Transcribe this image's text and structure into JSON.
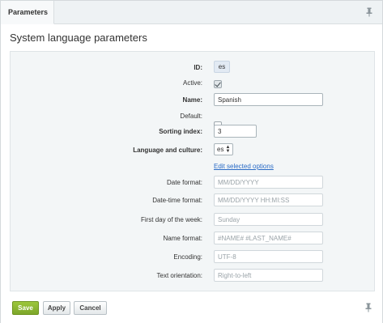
{
  "tab": {
    "label": "Parameters"
  },
  "title": "System language parameters",
  "form": {
    "id": {
      "label": "ID:",
      "value": "es"
    },
    "active": {
      "label": "Active:",
      "checked": true
    },
    "name": {
      "label": "Name:",
      "value": "Spanish"
    },
    "default": {
      "label": "Default:",
      "checked": false
    },
    "sorting_index": {
      "label": "Sorting index:",
      "value": "3"
    },
    "language_culture": {
      "label": "Language and culture:",
      "value": "es"
    },
    "edit_link": "Edit selected options",
    "date_format": {
      "label": "Date format:",
      "placeholder": "MM/DD/YYYY"
    },
    "datetime_format": {
      "label": "Date-time format:",
      "placeholder": "MM/DD/YYYY HH:MI:SS"
    },
    "first_day": {
      "label": "First day of the week:",
      "placeholder": "Sunday"
    },
    "name_format": {
      "label": "Name format:",
      "placeholder": "#NAME# #LAST_NAME#"
    },
    "encoding": {
      "label": "Encoding:",
      "placeholder": "UTF-8"
    },
    "text_orientation": {
      "label": "Text orientation:",
      "placeholder": "Right-to-left"
    }
  },
  "footer": {
    "save": "Save",
    "apply": "Apply",
    "cancel": "Cancel"
  },
  "colors": {
    "accent_green": "#8ab833",
    "link_blue": "#2a6bc6",
    "panel_bg": "#f3f6f7"
  },
  "icons": {
    "pin": "pin-icon",
    "checkbox_check": "check-icon",
    "select_arrows": "updown-arrows-icon"
  }
}
